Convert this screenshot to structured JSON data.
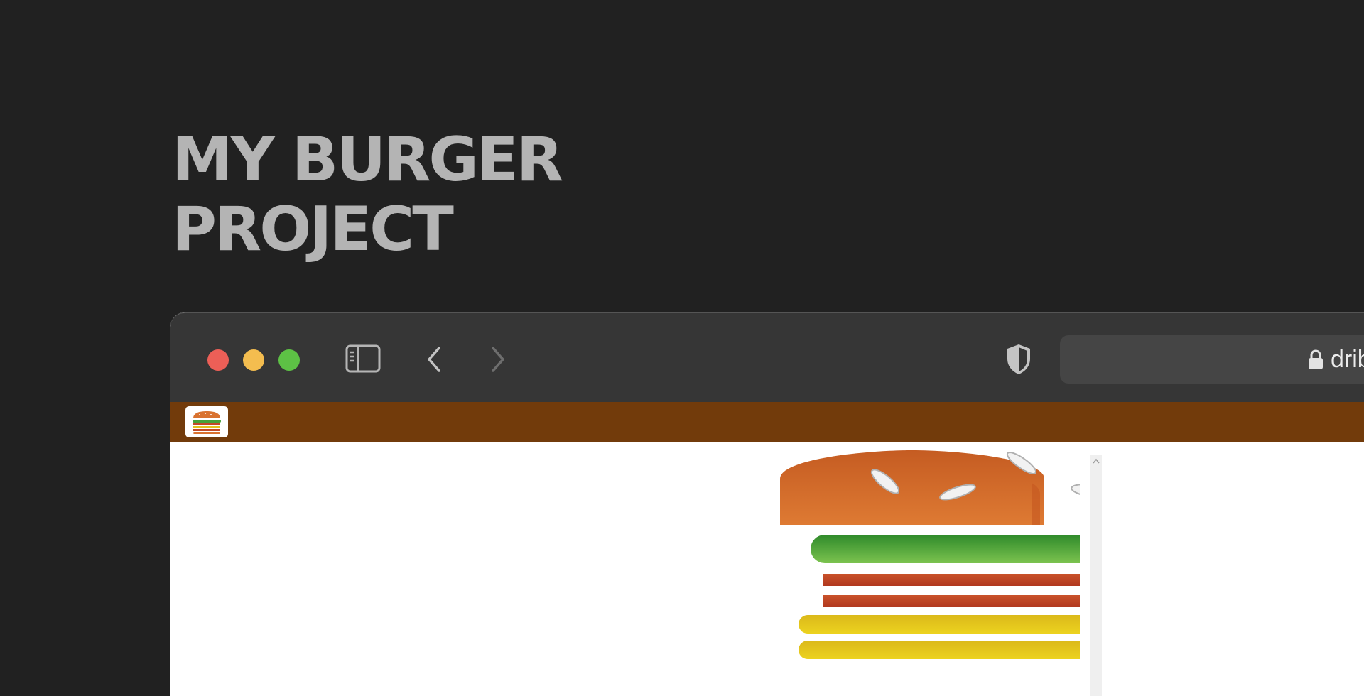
{
  "hero": {
    "title_line1": "MY BURGER",
    "title_line2": "PROJECT"
  },
  "browser": {
    "window_controls": [
      "close",
      "minimize",
      "maximize"
    ],
    "address": {
      "text": "dribbble.com"
    },
    "icons": {
      "sidebar": "sidebar-icon",
      "back": "chevron-left-icon",
      "forward": "chevron-right-icon",
      "privacy": "shield-icon",
      "lock": "lock-icon"
    }
  },
  "site": {
    "header_color": "#723b0b",
    "logo": "burger-logo-icon"
  },
  "burger": {
    "layers": [
      "top-bun",
      "lettuce",
      "tomato",
      "tomato",
      "cheese",
      "cheese"
    ],
    "colors": {
      "bun": "#d9722f",
      "lettuce": "#45a23a",
      "tomato": "#c24a27",
      "cheese": "#e5c31b"
    }
  }
}
